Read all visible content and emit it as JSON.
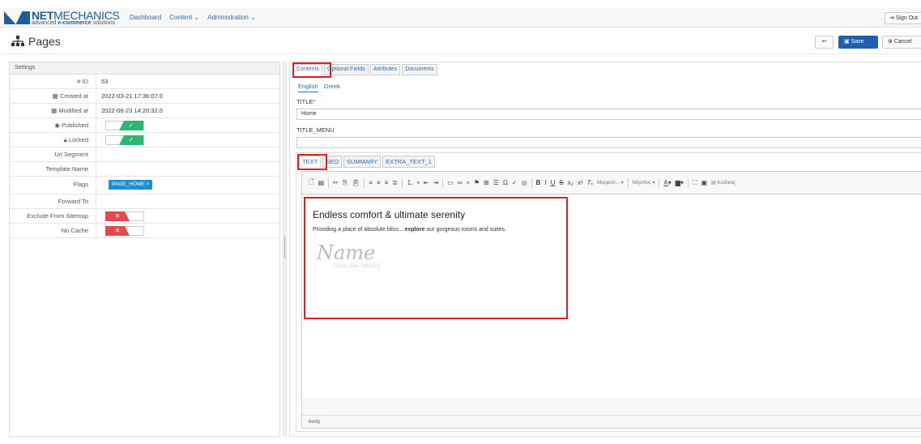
{
  "brand": {
    "name_bold": "NET",
    "name_rest": "MECHANICS",
    "tagline_pre": "advanced ",
    "tagline_bold": "e-commerce",
    "tagline_post": " solutions"
  },
  "nav": {
    "dashboard": "Dashboard",
    "content": "Content",
    "administration": "Administration",
    "signout": "Sign Out"
  },
  "page": {
    "title": "Pages"
  },
  "actions": {
    "save": "Save",
    "cancel": "Cancel"
  },
  "settings": {
    "heading": "Settings",
    "id_label": "ID",
    "id_value": "53",
    "created_label": "Created at",
    "created_value": "2022-03-21 17:36:07.0",
    "modified_label": "Modified at",
    "modified_value": "2022-06-23 14:20:32.0",
    "published_label": "Published",
    "published": true,
    "locked_label": "Locked",
    "locked": true,
    "url_label": "Url Segment",
    "template_label": "Template Name",
    "flags_label": "Flags",
    "flag_value": "PAGE_HOME",
    "forward_label": "Forward To",
    "exclude_label": "Exclude From Sitemap",
    "exclude": false,
    "nocache_label": "No Cache",
    "nocache": false
  },
  "tabs": [
    "Contents",
    "Optional Fields",
    "Attributes",
    "Documents"
  ],
  "languages": [
    "English",
    "Greek"
  ],
  "fields": {
    "title_label": "TITLE",
    "title_required": "*",
    "title_value": "Home",
    "title_menu_label": "TITLE_MENU",
    "title_menu_value": ""
  },
  "text_tabs": [
    "TEXT",
    "SEO",
    "SUMMARY",
    "EXTRA_TEXT_1"
  ],
  "toolbar": {
    "format": "Μορφοπ...",
    "size": "Μέγεθος",
    "source": "Κώδικας"
  },
  "editor": {
    "heading": "Endless comfort & ultimate serenity",
    "para_pre": "Providing a place of absolute bliss... ",
    "para_bold": "explore",
    "para_post": " our gorgeous rooms and suites.",
    "logo_text": "Name",
    "logo_tag": "TAGLINE SPACE",
    "status_path": "body"
  }
}
